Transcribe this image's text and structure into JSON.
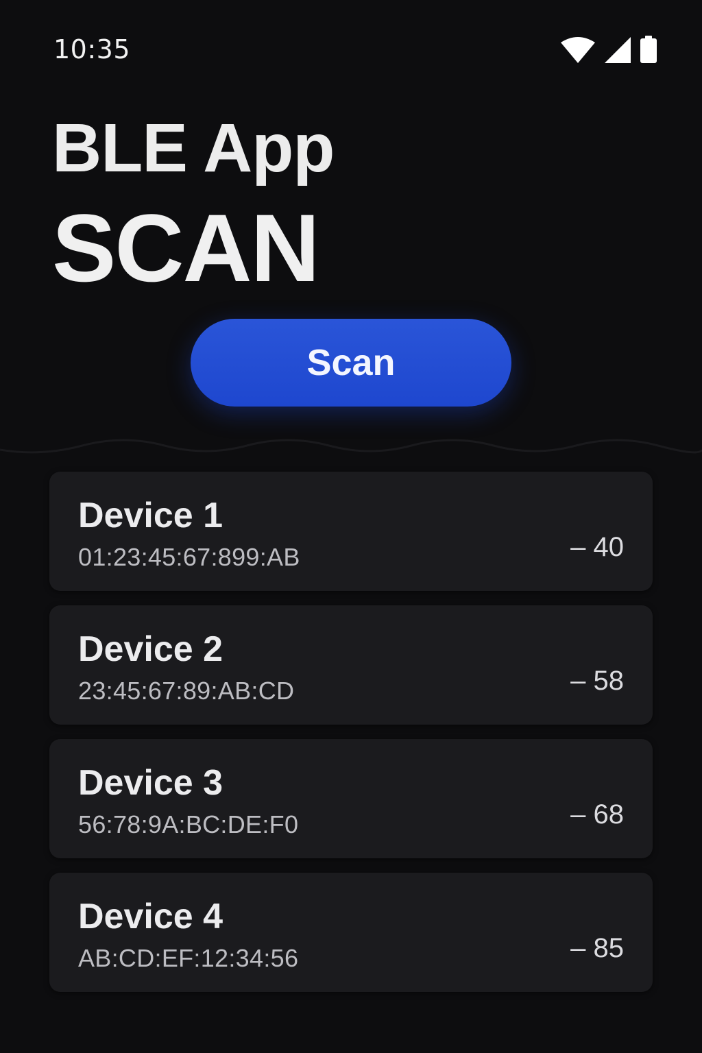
{
  "status_bar": {
    "time": "10:35",
    "icons": [
      "wifi-icon",
      "cell-signal-icon",
      "battery-icon"
    ]
  },
  "header": {
    "title": "BLE App",
    "subtitle": "SCAN"
  },
  "scan_button": {
    "label": "Scan",
    "color": "#1f4acf"
  },
  "devices": [
    {
      "name": "Device 1",
      "address": "01:23:45:67:899:AB",
      "rssi": "– 40"
    },
    {
      "name": "Device 2",
      "address": "23:45:67:89:AB:CD",
      "rssi": "– 58"
    },
    {
      "name": "Device 3",
      "address": "56:78:9A:BC:DE:F0",
      "rssi": "– 68"
    },
    {
      "name": "Device 4",
      "address": "AB:CD:EF:12:34:56",
      "rssi": "– 85"
    }
  ],
  "colors": {
    "background": "#0d0d0f",
    "card": "#1b1b1e",
    "accent": "#1f4acf"
  }
}
